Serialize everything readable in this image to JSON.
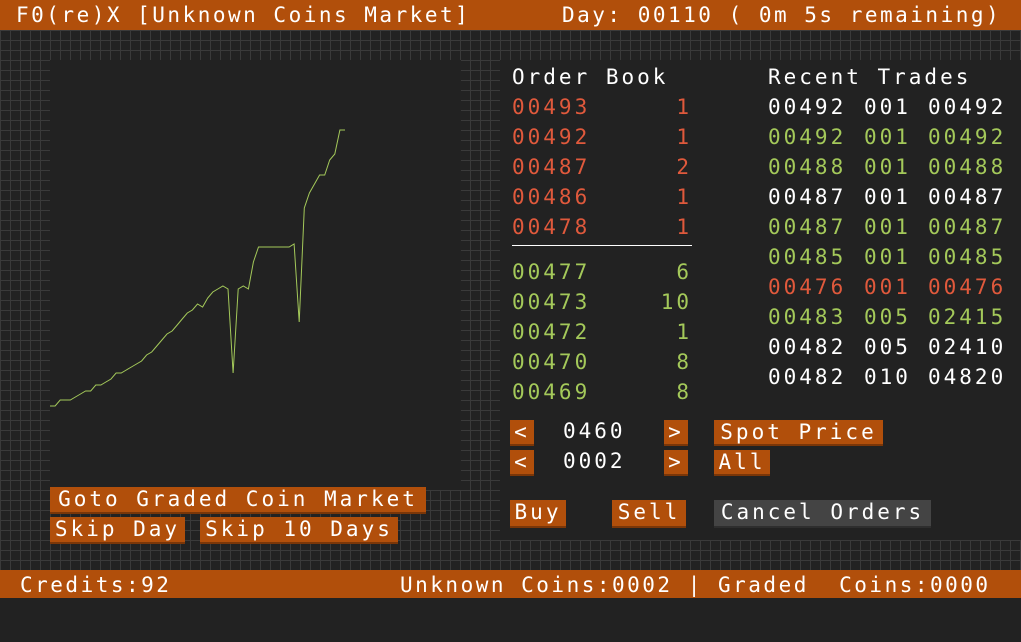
{
  "header": {
    "title": "F0(re)X [Unknown Coins Market]",
    "day_status": "Day: 00110 ( 0m 5s remaining)"
  },
  "order_book": {
    "title": "Order Book",
    "asks": [
      {
        "price": "00493",
        "qty": "1"
      },
      {
        "price": "00492",
        "qty": "1"
      },
      {
        "price": "00487",
        "qty": "2"
      },
      {
        "price": "00486",
        "qty": "1"
      },
      {
        "price": "00478",
        "qty": "1"
      }
    ],
    "bids": [
      {
        "price": "00477",
        "qty": "6"
      },
      {
        "price": "00473",
        "qty": "10"
      },
      {
        "price": "00472",
        "qty": "1"
      },
      {
        "price": "00470",
        "qty": "8"
      },
      {
        "price": "00469",
        "qty": "8"
      }
    ]
  },
  "recent_trades": {
    "title": "Recent Trades",
    "trades": [
      {
        "price": "00492",
        "qty": "001",
        "total": "00492",
        "side": "neutral"
      },
      {
        "price": "00492",
        "qty": "001",
        "total": "00492",
        "side": "buy"
      },
      {
        "price": "00488",
        "qty": "001",
        "total": "00488",
        "side": "buy"
      },
      {
        "price": "00487",
        "qty": "001",
        "total": "00487",
        "side": "neutral"
      },
      {
        "price": "00487",
        "qty": "001",
        "total": "00487",
        "side": "buy"
      },
      {
        "price": "00485",
        "qty": "001",
        "total": "00485",
        "side": "buy"
      },
      {
        "price": "00476",
        "qty": "001",
        "total": "00476",
        "side": "sell"
      },
      {
        "price": "00483",
        "qty": "005",
        "total": "02415",
        "side": "buy"
      },
      {
        "price": "00482",
        "qty": "005",
        "total": "02410",
        "side": "neutral"
      },
      {
        "price": "00482",
        "qty": "010",
        "total": "04820",
        "side": "neutral"
      }
    ]
  },
  "order_entry": {
    "price_value": "0460",
    "qty_value": "0002",
    "decrement_label": "<",
    "increment_label": ">",
    "spot_price_label": "Spot Price",
    "all_label": "All",
    "buy_label": "Buy",
    "sell_label": "Sell",
    "cancel_label": "Cancel Orders"
  },
  "nav": {
    "graded_market_label": "Goto Graded Coin Market",
    "skip_day_label": "Skip Day",
    "skip_10_days_label": "Skip 10 Days"
  },
  "footer": {
    "credits": "Credits:92",
    "holdings": "Unknown Coins:0002 | Graded  Coins:0000"
  },
  "colors": {
    "accent": "#b14f0b",
    "ask": "#e0593c",
    "bid": "#a4c95a",
    "background": "#222222",
    "chart_line": "#a4c95a"
  },
  "chart_data": {
    "type": "line",
    "title": "",
    "xlabel": "",
    "ylabel": "",
    "x": [
      1,
      2,
      3,
      4,
      5,
      6,
      7,
      8,
      9,
      10,
      11,
      12,
      13,
      14,
      15,
      16,
      17,
      18,
      19,
      20,
      21,
      22,
      23,
      24,
      25,
      26,
      27,
      28,
      29,
      30,
      31,
      32,
      33,
      34,
      35,
      36,
      37,
      38,
      39,
      40,
      41,
      42,
      43,
      44,
      45,
      46,
      47,
      48,
      49,
      50,
      51,
      52,
      53,
      54,
      55,
      56,
      57,
      58,
      59
    ],
    "values": [
      298,
      298,
      300,
      300,
      300,
      301,
      302,
      303,
      303,
      305,
      305,
      306,
      307,
      309,
      309,
      310,
      311,
      312,
      313,
      315,
      316,
      318,
      320,
      322,
      323,
      325,
      327,
      329,
      330,
      332,
      331,
      334,
      336,
      337,
      338,
      337,
      309,
      337,
      338,
      337,
      346,
      351,
      351,
      351,
      351,
      351,
      351,
      351,
      352,
      326,
      364,
      369,
      372,
      375,
      375,
      380,
      382,
      390,
      390
    ],
    "ylim": [
      270,
      400
    ]
  }
}
